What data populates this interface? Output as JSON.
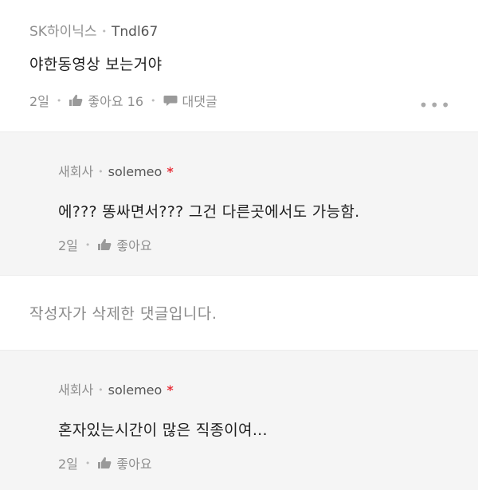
{
  "comment": {
    "company": "SK하이닉스",
    "nickname": "Tndl67",
    "text": "야한동영상 보는거야",
    "time": "2일",
    "like_label": "좋아요 16",
    "reply_label": "대댓글",
    "more_label": "•••"
  },
  "reply1": {
    "company": "새회사",
    "nickname": "solemeo",
    "author_mark": "*",
    "text": "에??? 똥싸면서??? 그건 다른곳에서도 가능함.",
    "time": "2일",
    "like_label": "좋아요"
  },
  "deleted": {
    "text": "작성자가 삭제한 댓글입니다."
  },
  "reply2": {
    "company": "새회사",
    "nickname": "solemeo",
    "author_mark": "*",
    "text": "혼자있는시간이 많은 직종이여...",
    "time": "2일",
    "like_label": "좋아요"
  },
  "colors": {
    "accent_star": "#e8323c",
    "meta_gray": "#8e8e8e",
    "reply_bg": "#f5f5f5"
  }
}
